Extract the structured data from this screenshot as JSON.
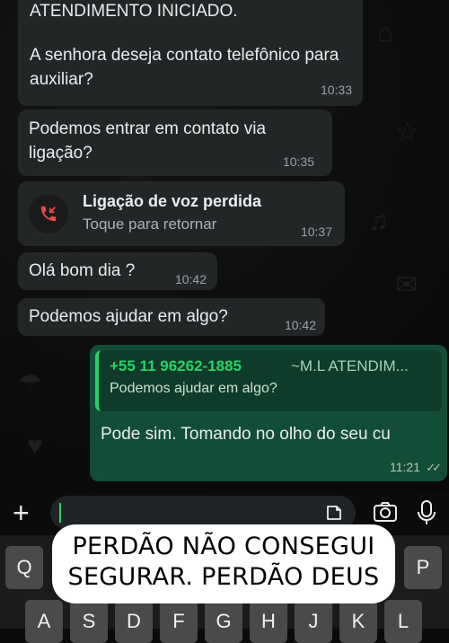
{
  "messages": [
    {
      "lines": [
        "ATENDIMENTO INICIADO.",
        "A senhora deseja contato telefônico para auxiliar?"
      ],
      "time": "10:33"
    },
    {
      "text": "Podemos entrar em contato via ligação?",
      "time": "10:35"
    },
    {
      "call_title": "Ligação de voz perdida",
      "call_sub": "Toque para retornar",
      "time": "10:37"
    },
    {
      "text": "Olá bom dia ?",
      "time": "10:42"
    },
    {
      "text": "Podemos ajudar em algo?",
      "time": "10:42"
    },
    {
      "quote_sender": "+55 11 96262-1885",
      "quote_name": "~M.L ATENDIM...",
      "quote_text": "Podemos ajudar em algo?",
      "text": "Pode sim. Tomando no olho do seu cu",
      "time": "11:21"
    }
  ],
  "keyboard_keys": [
    "Q",
    "P",
    "A",
    "S",
    "D",
    "F",
    "G",
    "H",
    "J",
    "K",
    "L"
  ],
  "caption": "PERDÃO NÃO CONSEGUI SEGURAR. PERDÃO DEUS",
  "colors": {
    "incoming": "#232626",
    "outgoing": "#144d37",
    "accent": "#25d366",
    "missed_call": "#e5484d"
  }
}
